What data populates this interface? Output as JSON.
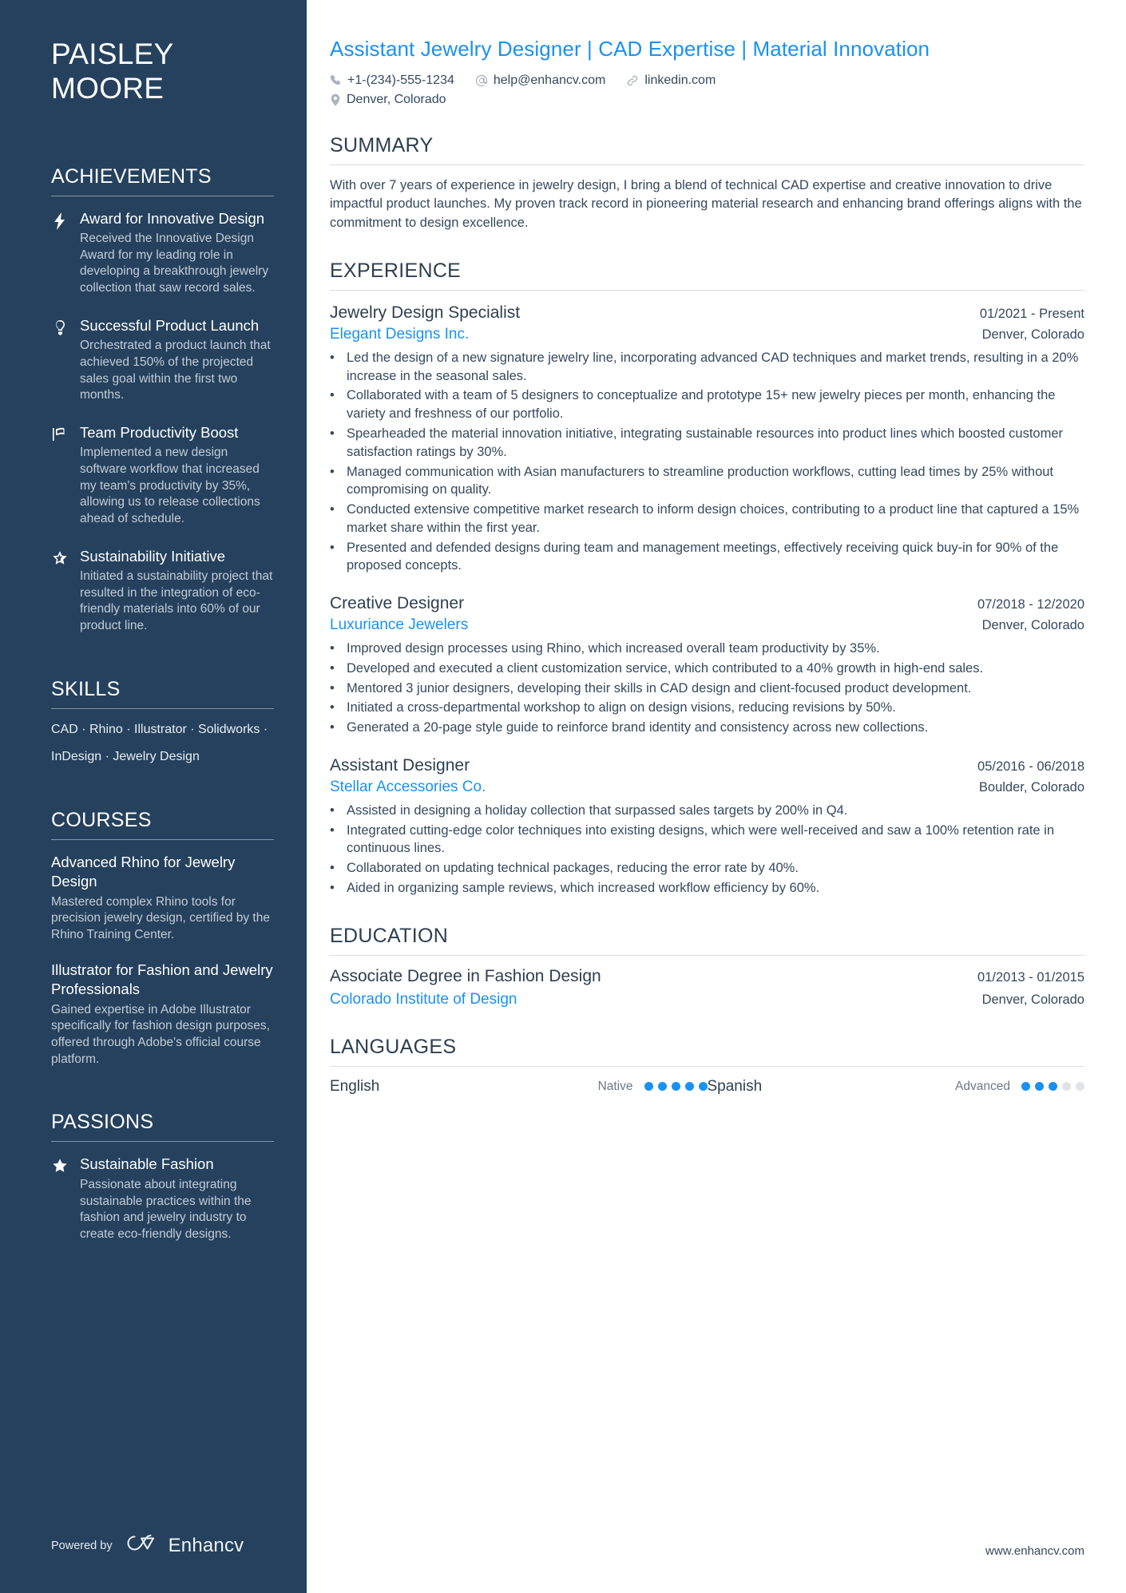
{
  "sidebar": {
    "name_first": "PAISLEY",
    "name_last": "MOORE",
    "achievements": {
      "heading": "ACHIEVEMENTS",
      "items": [
        {
          "icon": "lightning-bolt-icon",
          "title": "Award for Innovative Design",
          "desc": "Received the Innovative Design Award for my leading role in developing a breakthrough jewelry collection that saw record sales."
        },
        {
          "icon": "lightbulb-icon",
          "title": "Successful Product Launch",
          "desc": "Orchestrated a product launch that achieved 150% of the projected sales goal within the first two months."
        },
        {
          "icon": "flag-icon",
          "title": "Team Productivity Boost",
          "desc": "Implemented a new design software workflow that increased my team's productivity by 35%, allowing us to release collections ahead of schedule."
        },
        {
          "icon": "star-outline-icon",
          "title": "Sustainability Initiative",
          "desc": "Initiated a sustainability project that resulted in the integration of eco-friendly materials into 60% of our product line."
        }
      ]
    },
    "skills": {
      "heading": "SKILLS",
      "lines": [
        "CAD · Rhino · Illustrator · Solidworks ·",
        "InDesign · Jewelry Design"
      ]
    },
    "courses": {
      "heading": "COURSES",
      "items": [
        {
          "title": "Advanced Rhino for Jewelry Design",
          "desc": "Mastered complex Rhino tools for precision jewelry design, certified by the Rhino Training Center."
        },
        {
          "title": "Illustrator for Fashion and Jewelry Professionals",
          "desc": "Gained expertise in Adobe Illustrator specifically for fashion design purposes, offered through Adobe's official course platform."
        }
      ]
    },
    "passions": {
      "heading": "PASSIONS",
      "items": [
        {
          "icon": "star-filled-icon",
          "title": "Sustainable Fashion",
          "desc": "Passionate about integrating sustainable practices within the fashion and jewelry industry to create eco-friendly designs."
        }
      ]
    },
    "footer": {
      "powered_label": "Powered by",
      "brand": "Enhancv",
      "logo_icon": "enhancv-infinity-logo-icon"
    }
  },
  "main": {
    "headline": "Assistant Jewelry Designer | CAD Expertise | Material Innovation",
    "contact": [
      {
        "icon": "phone-icon",
        "value": "+1-(234)-555-1234"
      },
      {
        "icon": "at-email-icon",
        "value": "help@enhancv.com"
      },
      {
        "icon": "link-icon",
        "value": "linkedin.com"
      },
      {
        "icon": "location-pin-icon",
        "value": "Denver, Colorado"
      }
    ],
    "summary": {
      "heading": "SUMMARY",
      "text": "With over 7 years of experience in jewelry design, I bring a blend of technical CAD expertise and creative innovation to drive impactful product launches. My proven track record in pioneering material research and enhancing brand offerings aligns with the commitment to design excellence."
    },
    "experience": {
      "heading": "EXPERIENCE",
      "jobs": [
        {
          "title": "Jewelry Design Specialist",
          "date": "01/2021 - Present",
          "company": "Elegant Designs Inc.",
          "location": "Denver, Colorado",
          "bullets": [
            "Led the design of a new signature jewelry line, incorporating advanced CAD techniques and market trends, resulting in a 20% increase in the seasonal sales.",
            "Collaborated with a team of 5 designers to conceptualize and prototype 15+ new jewelry pieces per month, enhancing the variety and freshness of our portfolio.",
            "Spearheaded the material innovation initiative, integrating sustainable resources into product lines which boosted customer satisfaction ratings by 30%.",
            "Managed communication with Asian manufacturers to streamline production workflows, cutting lead times by 25% without compromising on quality.",
            "Conducted extensive competitive market research to inform design choices, contributing to a product line that captured a 15% market share within the first year.",
            "Presented and defended designs during team and management meetings, effectively receiving quick buy-in for 90% of the proposed concepts."
          ]
        },
        {
          "title": "Creative Designer",
          "date": "07/2018 - 12/2020",
          "company": "Luxuriance Jewelers",
          "location": "Denver, Colorado",
          "bullets": [
            "Improved design processes using Rhino, which increased overall team productivity by 35%.",
            "Developed and executed a client customization service, which contributed to a 40% growth in high-end sales.",
            "Mentored 3 junior designers, developing their skills in CAD design and client-focused product development.",
            "Initiated a cross-departmental workshop to align on design visions, reducing revisions by 50%.",
            "Generated a 20-page style guide to reinforce brand identity and consistency across new collections."
          ]
        },
        {
          "title": "Assistant Designer",
          "date": "05/2016 - 06/2018",
          "company": "Stellar Accessories Co.",
          "location": "Boulder, Colorado",
          "bullets": [
            "Assisted in designing a holiday collection that surpassed sales targets by 200% in Q4.",
            "Integrated cutting-edge color techniques into existing designs, which were well-received and saw a 100% retention rate in continuous lines.",
            "Collaborated on updating technical packages, reducing the error rate by 40%.",
            "Aided in organizing sample reviews, which increased workflow efficiency by 60%."
          ]
        }
      ]
    },
    "education": {
      "heading": "EDUCATION",
      "items": [
        {
          "degree": "Associate Degree in Fashion Design",
          "date": "01/2013 - 01/2015",
          "school": "Colorado Institute of Design",
          "location": "Denver, Colorado"
        }
      ]
    },
    "languages": {
      "heading": "LANGUAGES",
      "items": [
        {
          "name": "English",
          "level": "Native",
          "filled": 5,
          "total": 5
        },
        {
          "name": "Spanish",
          "level": "Advanced",
          "filled": 3,
          "total": 5
        }
      ]
    },
    "website": "www.enhancv.com"
  },
  "colors": {
    "sidebar_bg": "#25415d",
    "accent_blue": "#1a91f0",
    "body_text": "#35495e",
    "heading_text": "#2e3f50"
  }
}
